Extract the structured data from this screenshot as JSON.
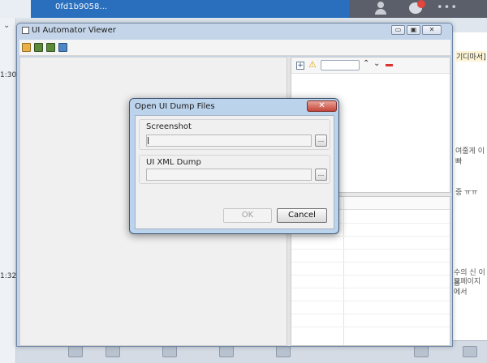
{
  "background": {
    "tab_hash": "0fd1b9058...",
    "time_top": "1:30",
    "time_bottom": "1:32",
    "right_snippets": [
      "기디마서]",
      "여줄게 이빠",
      "중 ㅠㅠ",
      "수의 신 이용",
      "모페이지에서"
    ]
  },
  "window": {
    "title": "UI Automator Viewer",
    "controls": {
      "minimize": "▭",
      "maximize": "▣",
      "close": "✕"
    }
  },
  "toolbar": {
    "icons": [
      "folder-open-icon",
      "device-screenshot-icon",
      "device-screenshot-compressed-icon",
      "save-icon"
    ]
  },
  "tree_toolbar": {
    "expand": "+",
    "warning": "⚠",
    "up": "⌃",
    "down": "⌄"
  },
  "dialog": {
    "title": "Open UI Dump Files",
    "close_label": "✕",
    "screenshot": {
      "label": "Screenshot",
      "value": "",
      "browse": "..."
    },
    "xml": {
      "label": "UI XML Dump",
      "value": "",
      "browse": "..."
    },
    "ok_label": "OK",
    "cancel_label": "Cancel"
  },
  "colors": {
    "accent": "#2a6fbd",
    "window_frame": "#c4d5ea",
    "dialog_frame": "#bcd3ec",
    "close_button": "#c4453a"
  }
}
